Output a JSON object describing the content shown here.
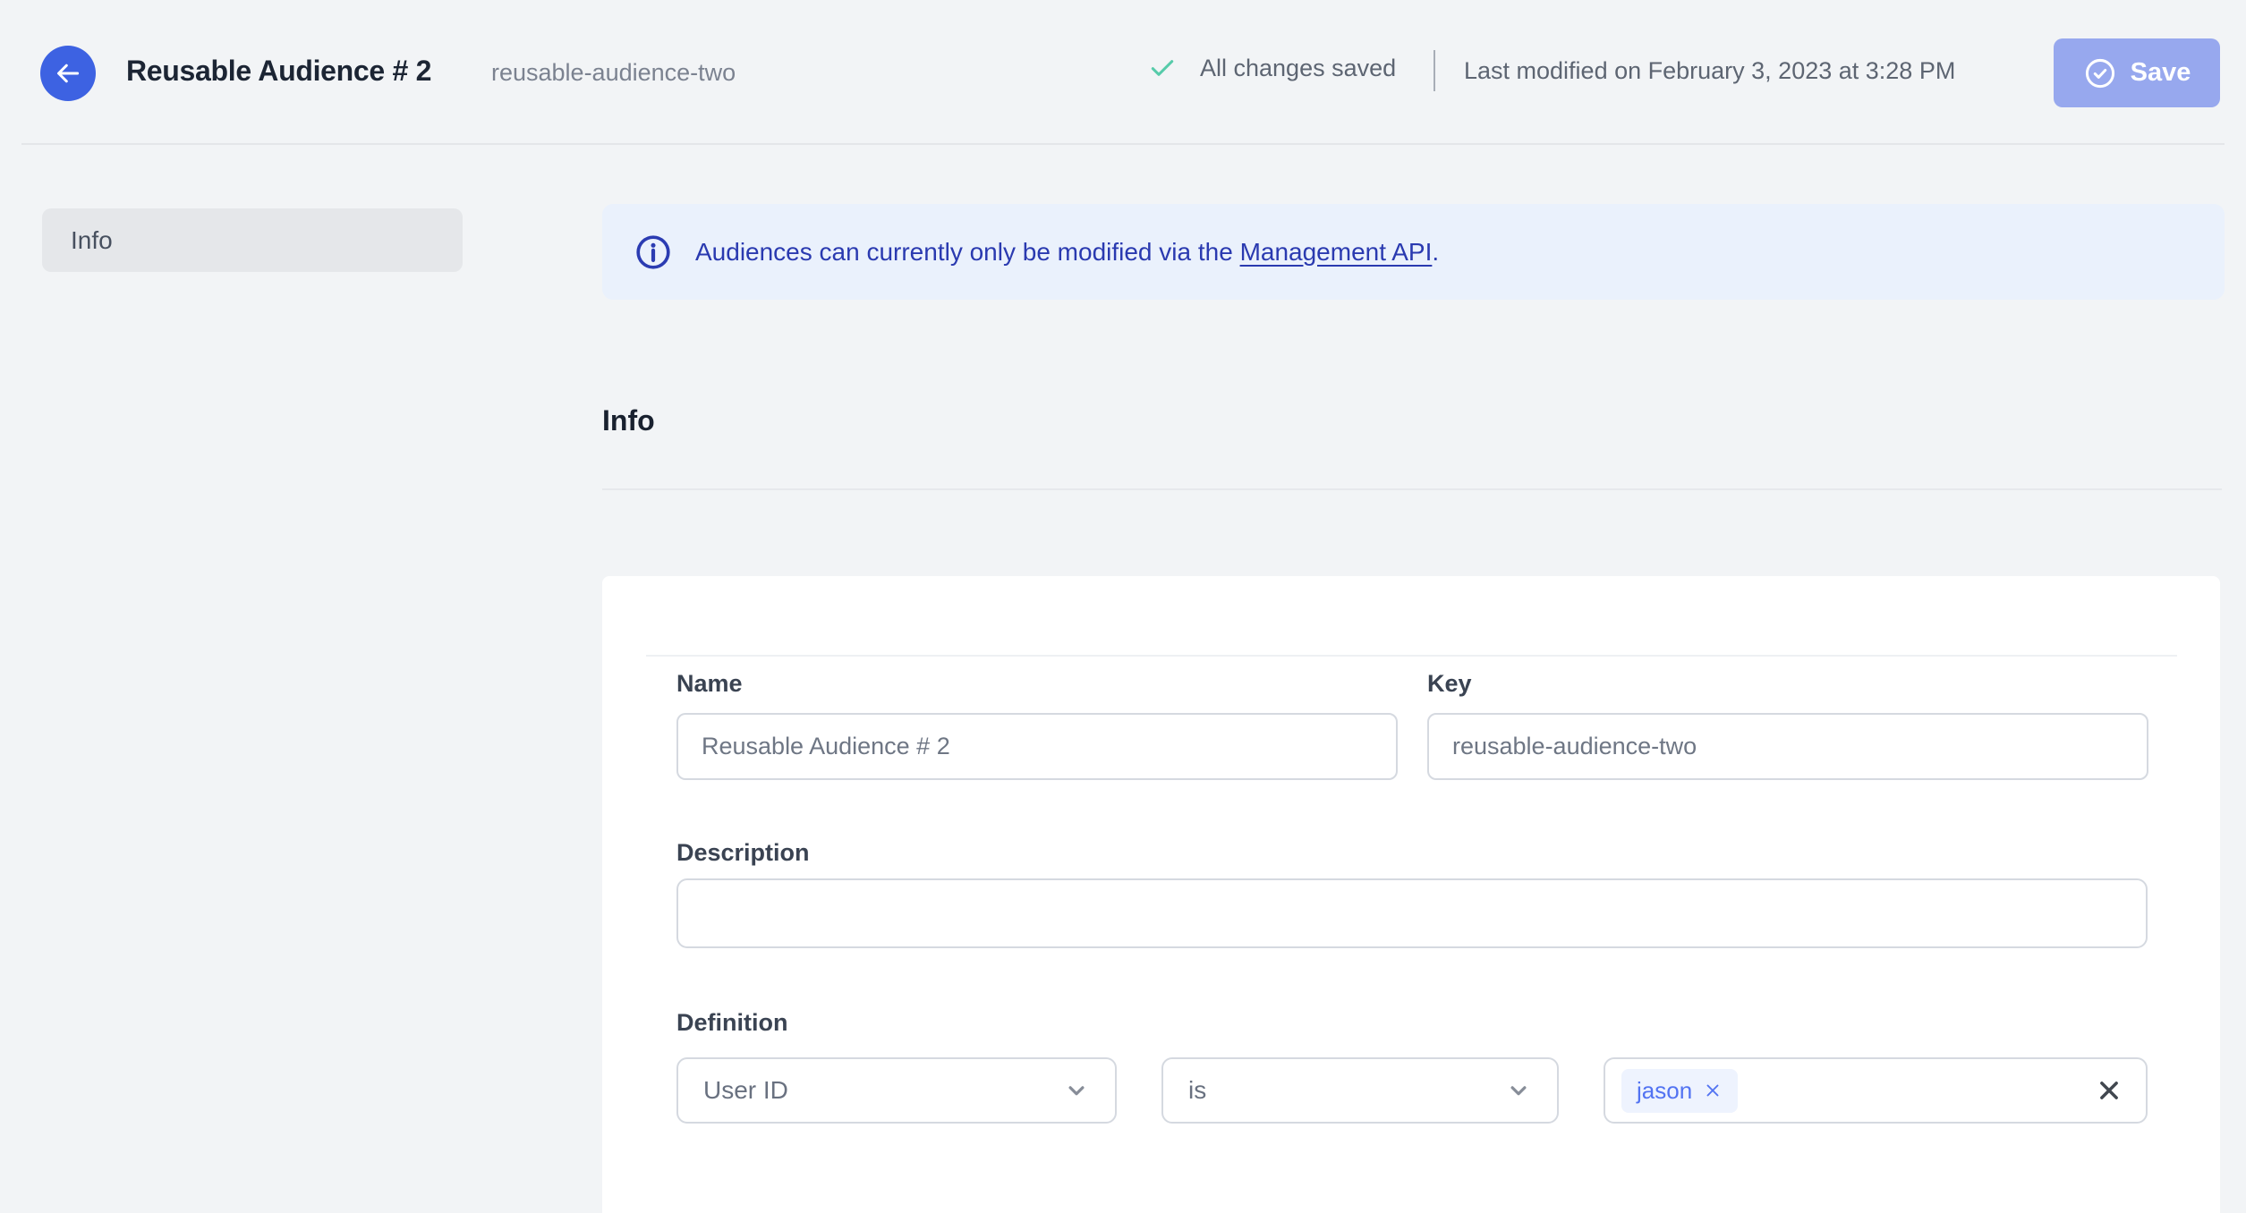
{
  "header": {
    "title": "Reusable Audience # 2",
    "subtitle": "reusable-audience-two",
    "status_saved": "All changes saved",
    "last_modified": "Last modified on February 3, 2023 at 3:28 PM",
    "save_label": "Save"
  },
  "sidebar": {
    "items": [
      {
        "label": "Info",
        "active": true
      }
    ]
  },
  "banner": {
    "text": "Audiences can currently only be modified via the ",
    "link_label": "Management API",
    "suffix": "."
  },
  "section": {
    "heading": "Info"
  },
  "form": {
    "name_label": "Name",
    "name_value": "Reusable Audience # 2",
    "key_label": "Key",
    "key_value": "reusable-audience-two",
    "description_label": "Description",
    "description_value": "",
    "definition_label": "Definition",
    "attribute_selected": "User ID",
    "operator_selected": "is",
    "value_chips": [
      {
        "label": "jason"
      }
    ]
  },
  "icons": {
    "back": "arrow-left-icon",
    "saved": "check-icon",
    "save": "circle-check-icon",
    "banner": "info-circle-icon",
    "selects": "chevron-down-icon",
    "chip_remove": "x-icon",
    "clear_values": "x-icon"
  },
  "colors": {
    "page_bg": "#f2f4f6",
    "primary_blue": "#3d62e2",
    "save_button_disabled": "#97a8ee",
    "success_green": "#57cbaa",
    "banner_bg": "#eaf1fc",
    "banner_text": "#2a3ab0",
    "card_bg": "#ffffff",
    "input_border": "#d5d9e0",
    "chip_bg": "#eef3fe",
    "chip_text": "#5273f2",
    "title_text": "#1c2534",
    "muted_text": "#5d6572"
  }
}
